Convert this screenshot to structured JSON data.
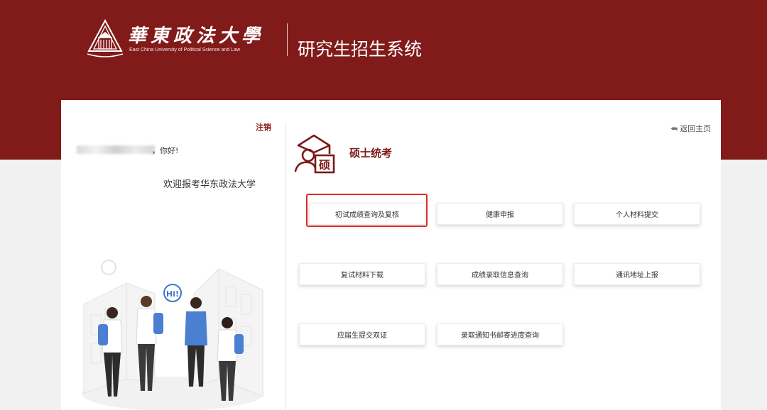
{
  "header": {
    "logo_cn": "華東政法大學",
    "logo_en": "East China University of Political Science and Law",
    "system_title": "研究生招生系统"
  },
  "left_panel": {
    "logout": "注销",
    "greeting_suffix": "，你好!",
    "welcome": "欢迎报考华东政法大学",
    "illustration_bubble": "Hi!"
  },
  "right_panel": {
    "back_home": "返回主页",
    "section_title": "硕士统考",
    "section_icon_char": "硕",
    "buttons": [
      "初试成绩查询及复核",
      "健康申报",
      "个人材料提交",
      "复试材料下载",
      "成绩录取信息查询",
      "通讯地址上报",
      "应届生提交双证",
      "录取通知书邮寄进度查询"
    ],
    "highlighted_button": "初试成绩查询及复核"
  },
  "colors": {
    "brand_red": "#811b19",
    "title_red": "#7a1a18",
    "highlight_border": "#e02b2b"
  }
}
